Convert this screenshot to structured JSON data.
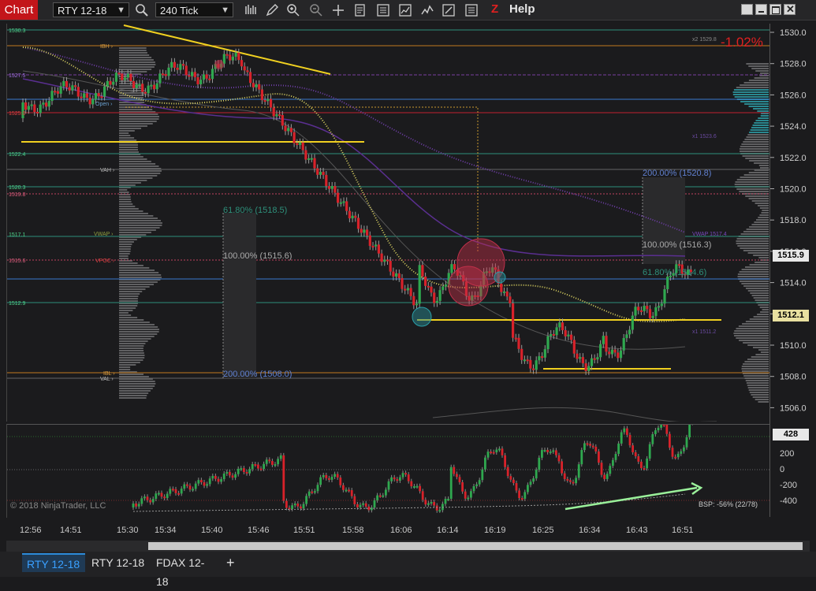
{
  "toolbar": {
    "chart_label": "Chart",
    "instrument": "RTY 12-18",
    "interval": "240 Tick",
    "help_label": "Help",
    "z_label": "Z"
  },
  "chart": {
    "pct_change": "-1.02%",
    "last_price": "1515.9",
    "level_price": "1512.1",
    "indicator_value": "428",
    "copyright": "© 2018 NinjaTrader, LLC",
    "bsp_text": "BSP: -56% (22/78)",
    "y_ticks": [
      "1530.0",
      "1528.0",
      "1526.0",
      "1524.0",
      "1522.0",
      "1520.0",
      "1518.0",
      "1516.0",
      "1514.0",
      "1512.0",
      "1510.0",
      "1508.0",
      "1506.0"
    ],
    "ind_ticks": [
      "200",
      "0",
      "-200",
      "-400"
    ],
    "x_ticks": [
      "12:56",
      "14:51",
      "15:30",
      "15:34",
      "15:40",
      "15:46",
      "15:51",
      "15:58",
      "16:06",
      "16:14",
      "16:19",
      "16:25",
      "16:34",
      "16:43",
      "16:51"
    ],
    "left_levels": [
      {
        "label": "1530.3",
        "color": "#4fd48a"
      },
      {
        "label": "IBH",
        "color": "#e0a040"
      },
      {
        "label": "1527.5",
        "color": "#a070e0"
      },
      {
        "label": "Open",
        "color": "#6aa0d0"
      },
      {
        "label": "1525.0",
        "color": "#e04040"
      },
      {
        "label": "1522.4",
        "color": "#4fd48a"
      },
      {
        "label": "VAH",
        "color": "#bbbbbb"
      },
      {
        "label": "1520.3",
        "color": "#4fd48a"
      },
      {
        "label": "1519.8",
        "color": "#e06080"
      },
      {
        "label": "1517.1",
        "color": "#4fd48a"
      },
      {
        "label": "VWAP",
        "color": "#90a040"
      },
      {
        "label": "1515.6",
        "color": "#e06080"
      },
      {
        "label": "VPOC",
        "color": "#e04040"
      },
      {
        "label": "1512.9",
        "color": "#4fd48a"
      },
      {
        "label": "IBL",
        "color": "#e0a040"
      },
      {
        "label": "VAL",
        "color": "#bbbbbb"
      }
    ],
    "fib_labels": [
      "61.80% (1518.5)",
      "100.00% (1515.6)",
      "200.00% (1508.0)",
      "200.00% (1520.8)",
      "100.00% (1516.3)",
      "61.80% (1514.6)"
    ],
    "right_notes": [
      "x2 1529.8",
      "x1 1523.6",
      "VWAP 1517.4",
      "x1 1511.2"
    ]
  },
  "tabs": [
    "RTY 12-18",
    "RTY 12-18",
    "FDAX 12-18",
    "+"
  ],
  "colors": {
    "up": "#2fa84f",
    "down": "#d8222a",
    "ma": "#d8d060",
    "vwap": "#7a3fb8",
    "accent": "#c3151a",
    "tab_active": "#3aa0ff"
  }
}
